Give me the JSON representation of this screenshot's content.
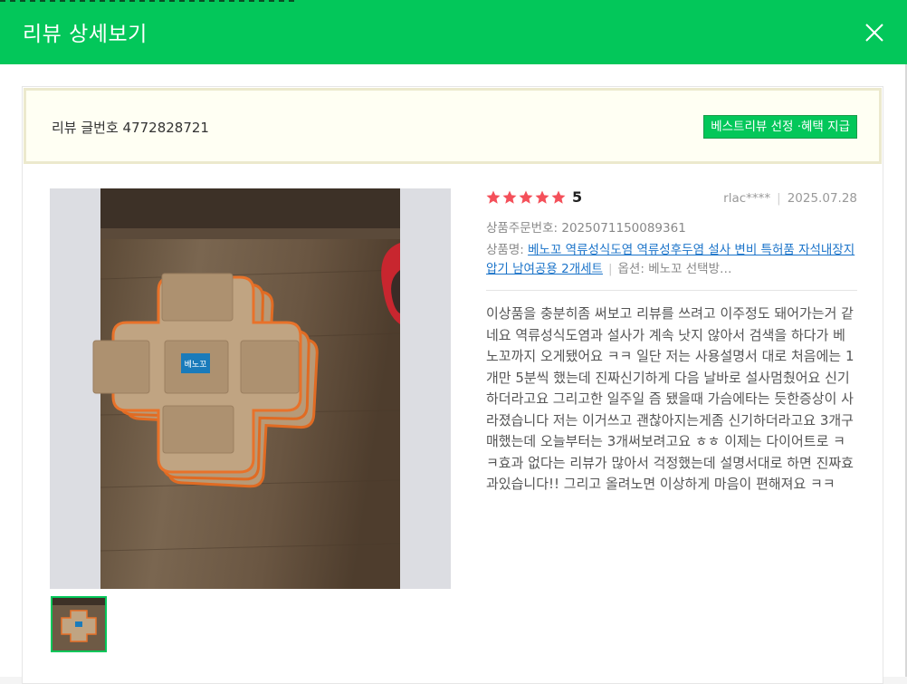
{
  "header": {
    "title": "리뷰 상세보기",
    "close_label": "닫기"
  },
  "review": {
    "number_label": "리뷰 글번호 4772828721",
    "best_badge": "베스트리뷰 선정 ·혜택 지급",
    "rating": 5,
    "rating_text": "5",
    "author": "rlac****",
    "date": "2025.07.28",
    "order_number": "상품주문번호: 2025071150089361",
    "product_label": "상품명:",
    "product_name": "베노꼬 역류성식도염 역류성후두염 설사 변비 특허품 자석내장지압기 남여공용 2개세트",
    "option_text": "옵션: 베노꼬 선택방…",
    "body": "이상품을 충분히좀 써보고 리뷰를 쓰려고 이주정도 돼어가는거 같네요 역류성식도염과 설사가 계속 낫지 않아서 검색을 하다가 베노꼬까지 오게됐어요 ㅋㅋ 일단 저는 사용설명서 대로 처음에는 1개만 5분씩 했는데 진짜신기하게 다음 날바로 설사멈췄어요 신기하더라고요 그리고한 일주일 즘 됐을때 가슴에타는 듯한증상이 사라졌습니다 저는 이거쓰고 괜찮아지는게좀 신기하더라고요 3개구매했는데 오늘부터는 3개써보려고요 ㅎㅎ 이제는 다이어트로 ㅋㅋ효과 없다는 리뷰가 많아서 걱정했는데 설명서대로 하면 진짜효과있습니다!! 그리고 올려노면 이상하게 마음이 편해져요 ㅋㅋ",
    "product_logo_text": "베노꼬"
  },
  "colors": {
    "brand_green": "#03c75a",
    "star_red": "#f4505a",
    "link_blue": "#1a73c9"
  }
}
